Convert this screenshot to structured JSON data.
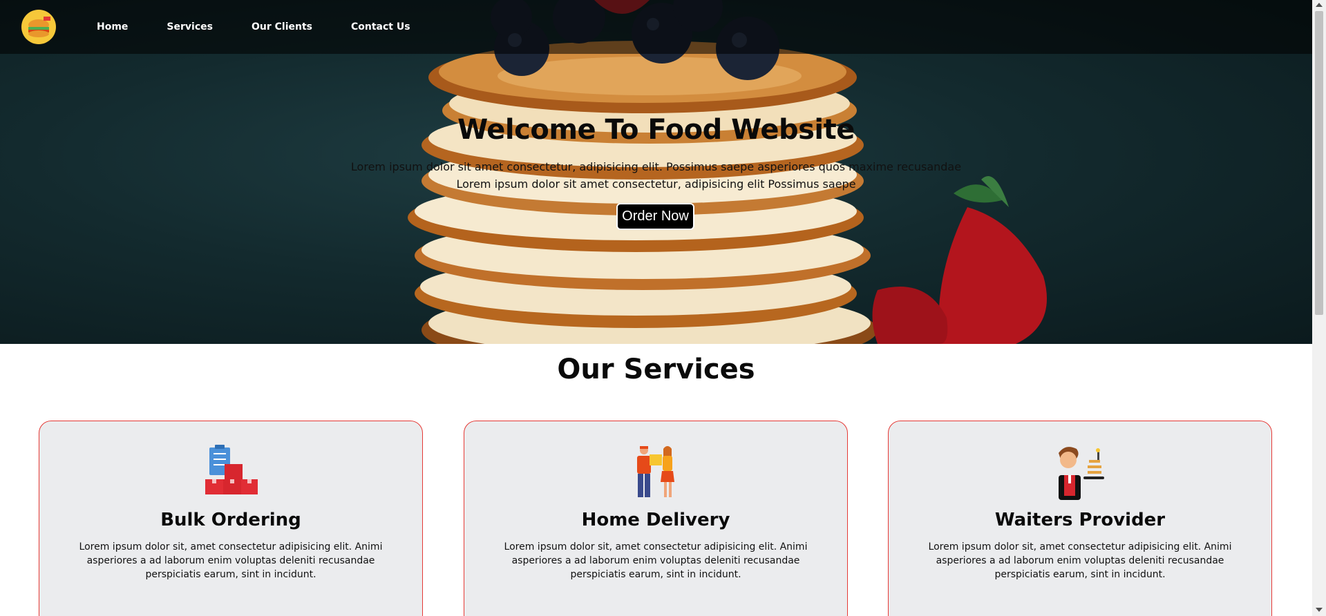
{
  "nav": {
    "logo_icon": "food-logo-icon",
    "links": [
      "Home",
      "Services",
      "Our Clients",
      "Contact Us"
    ]
  },
  "hero": {
    "title": "Welcome To Food Website",
    "line1": "Lorem ipsum dolor sit amet consectetur, adipisicing elit. Possimus saepe asperiores quos maxime recusandae",
    "line2": "Lorem ipsum dolor sit amet consectetur, adipisicing elit Possimus saepe",
    "order_button": "Order Now",
    "background_image": "pancake-stack-with-blueberries-and-strawberries"
  },
  "services": {
    "title": "Our Services",
    "cards": [
      {
        "icon": "bulk-boxes-icon",
        "title": "Bulk Ordering",
        "text": "Lorem ipsum dolor sit, amet consectetur adipisicing elit. Animi asperiores a ad laborum enim voluptas deleniti recusandae perspiciatis earum, sint in incidunt."
      },
      {
        "icon": "delivery-people-icon",
        "title": "Home Delivery",
        "text": "Lorem ipsum dolor sit, amet consectetur adipisicing elit. Animi asperiores a ad laborum enim voluptas deleniti recusandae perspiciatis earum, sint in incidunt."
      },
      {
        "icon": "waiter-icon",
        "title": "Waiters Provider",
        "text": "Lorem ipsum dolor sit, amet consectetur adipisicing elit. Animi asperiores a ad laborum enim voluptas deleniti recusandae perspiciatis earum, sint in incidunt."
      }
    ]
  },
  "colors": {
    "card_border": "#e53935",
    "card_background": "#ebecee",
    "button_background": "#000000",
    "nav_background": "rgba(0,0,0,0.55)"
  }
}
